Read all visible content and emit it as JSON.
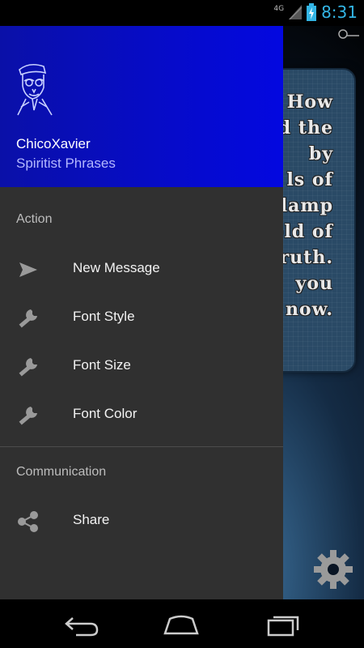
{
  "status_bar": {
    "network": "4G",
    "time": "8:31"
  },
  "background_quote": {
    "lines": [
      "! How",
      "d the",
      "by",
      "ls of",
      "lamp",
      "old of",
      "Truth.",
      "you",
      "now."
    ]
  },
  "drawer": {
    "header": {
      "title": "ChicoXavier",
      "subtitle": "Spiritist Phrases"
    },
    "sections": [
      {
        "title": "Action",
        "items": [
          {
            "label": "New Message",
            "icon": "send-icon"
          },
          {
            "label": "Font Style",
            "icon": "wrench-icon"
          },
          {
            "label": "Font Size",
            "icon": "wrench-icon"
          },
          {
            "label": "Font Color",
            "icon": "wrench-icon"
          }
        ]
      },
      {
        "title": "Communication",
        "items": [
          {
            "label": "Share",
            "icon": "share-icon"
          }
        ]
      }
    ]
  },
  "colors": {
    "header_gradient_start": "#0a10a8",
    "header_gradient_end": "#0308e0",
    "drawer_bg": "#303030",
    "accent": "#33b5e5"
  },
  "nav_bar": {
    "buttons": [
      "back",
      "home",
      "recents"
    ]
  }
}
